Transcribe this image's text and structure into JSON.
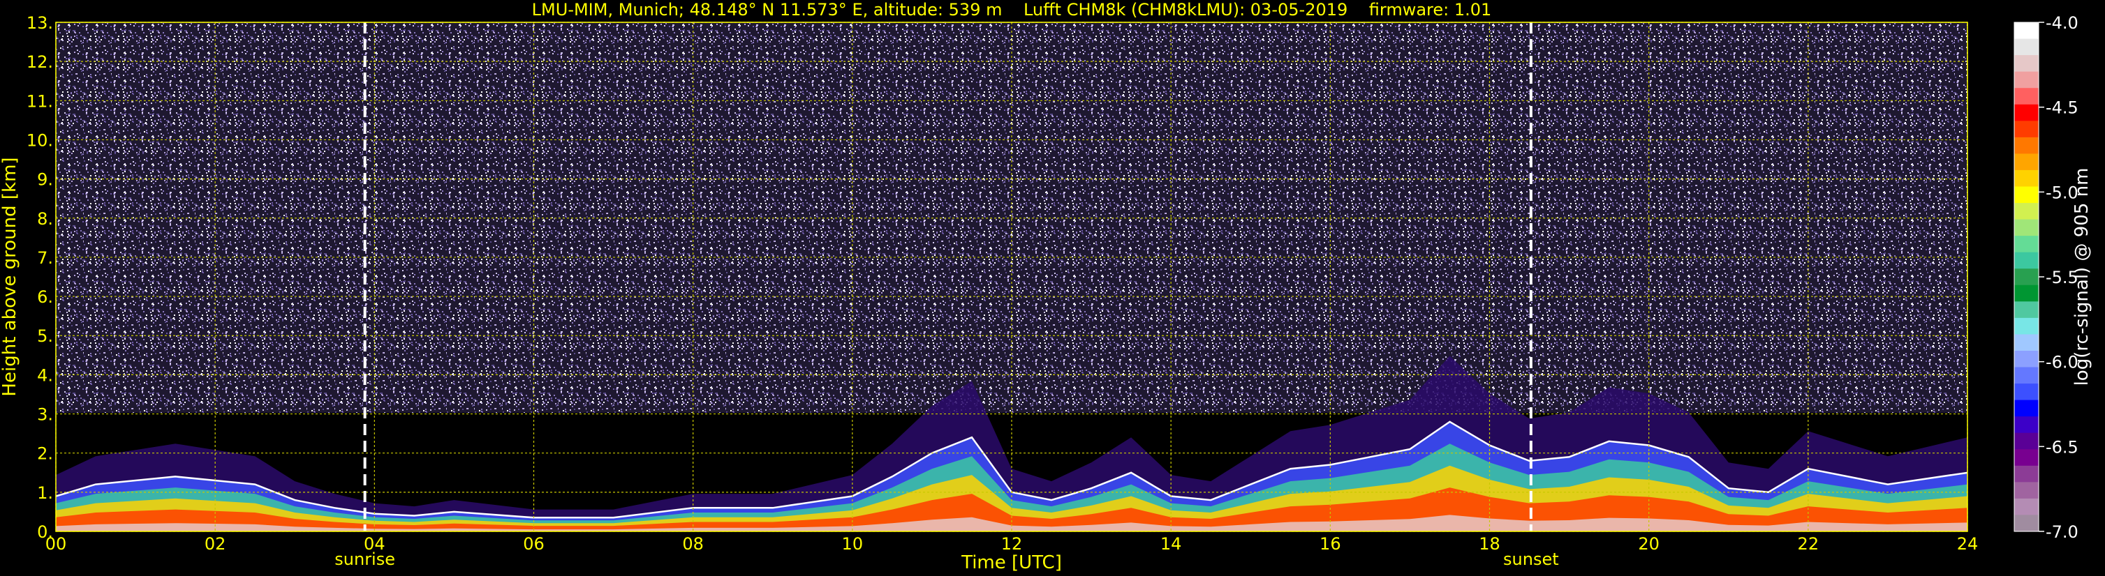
{
  "chart_data": {
    "type": "heatmap",
    "title": "LMU-MIM, Munich; 48.148° N 11.573° E, altitude: 539 m    Lufft CHM8k (CHM8kLMU): 03-05-2019    firmware: 1.01",
    "xlabel": "Time [UTC]",
    "ylabel": "Height above ground [km]",
    "xlim": [
      0,
      24
    ],
    "ylim": [
      0,
      13
    ],
    "x_ticks": [
      "00",
      "02",
      "04",
      "06",
      "08",
      "10",
      "12",
      "14",
      "16",
      "18",
      "20",
      "22",
      "24"
    ],
    "y_ticks": [
      "0.",
      "1.",
      "2.",
      "3.",
      "4.",
      "5.",
      "6.",
      "7.",
      "8.",
      "9.",
      "10.",
      "11.",
      "12.",
      "13."
    ],
    "grid": true,
    "annotations": [
      {
        "label": "sunrise",
        "x": 3.88
      },
      {
        "label": "sunset",
        "x": 18.52
      }
    ],
    "colorbar": {
      "label": "log(rc-signal) @ 905 nm",
      "min": -7.0,
      "max": -4.0,
      "ticks": [
        "-4.0",
        "-4.5",
        "-5.0",
        "-5.5",
        "-6.0",
        "-6.5",
        "-7.0"
      ],
      "colors": [
        "#ffffff",
        "#e6e6e6",
        "#e6c8c8",
        "#f0a0a0",
        "#ff6060",
        "#ff0000",
        "#ff3c00",
        "#ff7800",
        "#ffa500",
        "#ffd200",
        "#ffff00",
        "#d2f050",
        "#a0e678",
        "#64dc96",
        "#3cc8a0",
        "#28a050",
        "#009632",
        "#50c8a0",
        "#78e6e6",
        "#a0c8ff",
        "#8ca0ff",
        "#6478ff",
        "#3c50ff",
        "#0000ff",
        "#3c00c8",
        "#5a0096",
        "#780090",
        "#8c3c96",
        "#a064a0",
        "#b48cb4",
        "#a08ca0"
      ]
    },
    "boundary_layer": [
      [
        0,
        0.9
      ],
      [
        0.5,
        1.2
      ],
      [
        1,
        1.3
      ],
      [
        1.5,
        1.4
      ],
      [
        2,
        1.3
      ],
      [
        2.5,
        1.2
      ],
      [
        3,
        0.8
      ],
      [
        3.5,
        0.6
      ],
      [
        4,
        0.45
      ],
      [
        4.5,
        0.4
      ],
      [
        5,
        0.5
      ],
      [
        6,
        0.35
      ],
      [
        7,
        0.35
      ],
      [
        8,
        0.6
      ],
      [
        9,
        0.6
      ],
      [
        10,
        0.9
      ],
      [
        10.5,
        1.4
      ],
      [
        11,
        2.0
      ],
      [
        11.5,
        2.4
      ],
      [
        12,
        1.0
      ],
      [
        12.5,
        0.8
      ],
      [
        13,
        1.1
      ],
      [
        13.5,
        1.5
      ],
      [
        14,
        0.9
      ],
      [
        14.5,
        0.8
      ],
      [
        15,
        1.2
      ],
      [
        15.5,
        1.6
      ],
      [
        16,
        1.7
      ],
      [
        16.5,
        1.9
      ],
      [
        17,
        2.1
      ],
      [
        17.5,
        2.8
      ],
      [
        18,
        2.2
      ],
      [
        18.5,
        1.8
      ],
      [
        19,
        1.9
      ],
      [
        19.5,
        2.3
      ],
      [
        20,
        2.2
      ],
      [
        20.5,
        1.9
      ],
      [
        21,
        1.1
      ],
      [
        21.5,
        1.0
      ],
      [
        22,
        1.6
      ],
      [
        22.5,
        1.4
      ],
      [
        23,
        1.2
      ],
      [
        24,
        1.5
      ]
    ],
    "background_noise_color": "#6a5a96"
  }
}
